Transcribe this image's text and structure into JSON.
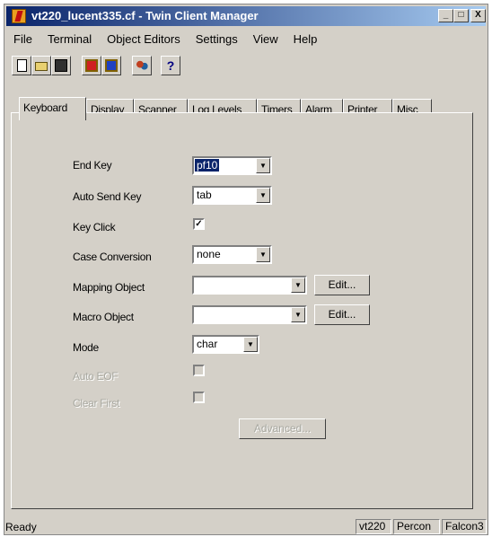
{
  "window": {
    "title": "vt220_lucent335.cf - Twin Client Manager",
    "controls": [
      "_",
      "□",
      "X"
    ]
  },
  "menu": [
    "File",
    "Terminal",
    "Object Editors",
    "Settings",
    "View",
    "Help"
  ],
  "toolbar": {
    "icons": [
      "new-file-icon",
      "open-folder-icon",
      "save-icon",
      "terminal-icon-1",
      "terminal-icon-2",
      "users-icon",
      "help-icon"
    ]
  },
  "tabs": [
    "Keyboard",
    "Display",
    "Scanner",
    "Log Levels",
    "Timers",
    "Alarm",
    "Printer",
    "Misc"
  ],
  "active_tab": "Keyboard",
  "form": {
    "end_key_label": "End Key",
    "end_key_value": "pf10",
    "auto_send_key_label": "Auto Send Key",
    "auto_send_key_value": "tab",
    "key_click_label": "Key Click",
    "key_click_checked": "✓",
    "case_conversion_label": "Case Conversion",
    "case_conversion_value": "none",
    "mapping_object_label": "Mapping Object",
    "mapping_object_value": "",
    "macro_object_label": "Macro Object",
    "macro_object_value": "",
    "mode_label": "Mode",
    "mode_value": "char",
    "auto_eof_label": "Auto EOF",
    "clear_first_label": "Clear First",
    "edit_label": "Edit...",
    "advanced_label": "Advanced..."
  },
  "status": {
    "left": "Ready",
    "panes": [
      "vt220",
      "Percon",
      "Falcon3"
    ]
  }
}
